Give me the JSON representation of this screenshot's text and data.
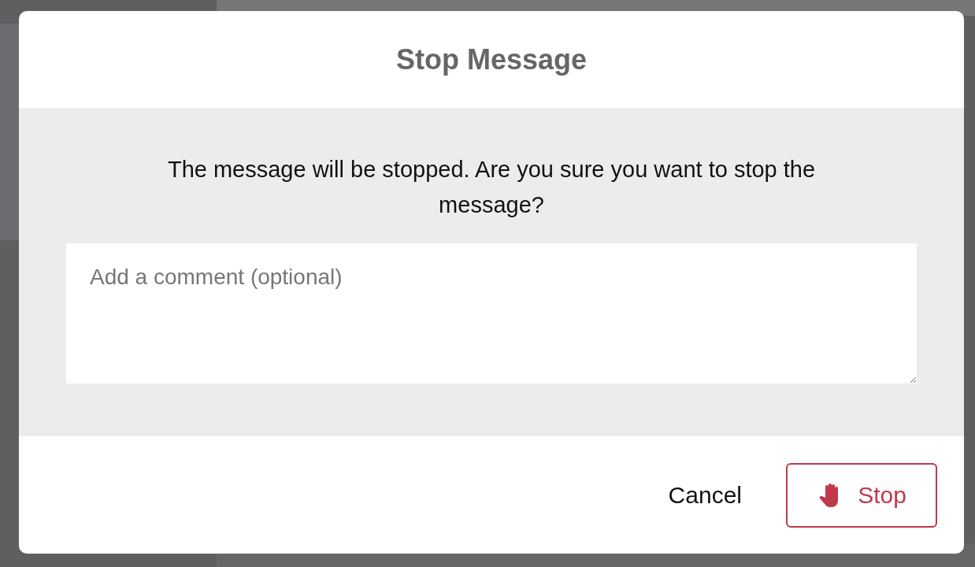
{
  "dialog": {
    "title": "Stop Message",
    "message": "The message will be stopped. Are you sure you want to stop the message?",
    "comment": {
      "placeholder": "Add a comment (optional)"
    },
    "buttons": [
      {
        "kind": "plain",
        "label": "Cancel"
      },
      {
        "kind": "danger",
        "label": "Stop"
      }
    ]
  }
}
